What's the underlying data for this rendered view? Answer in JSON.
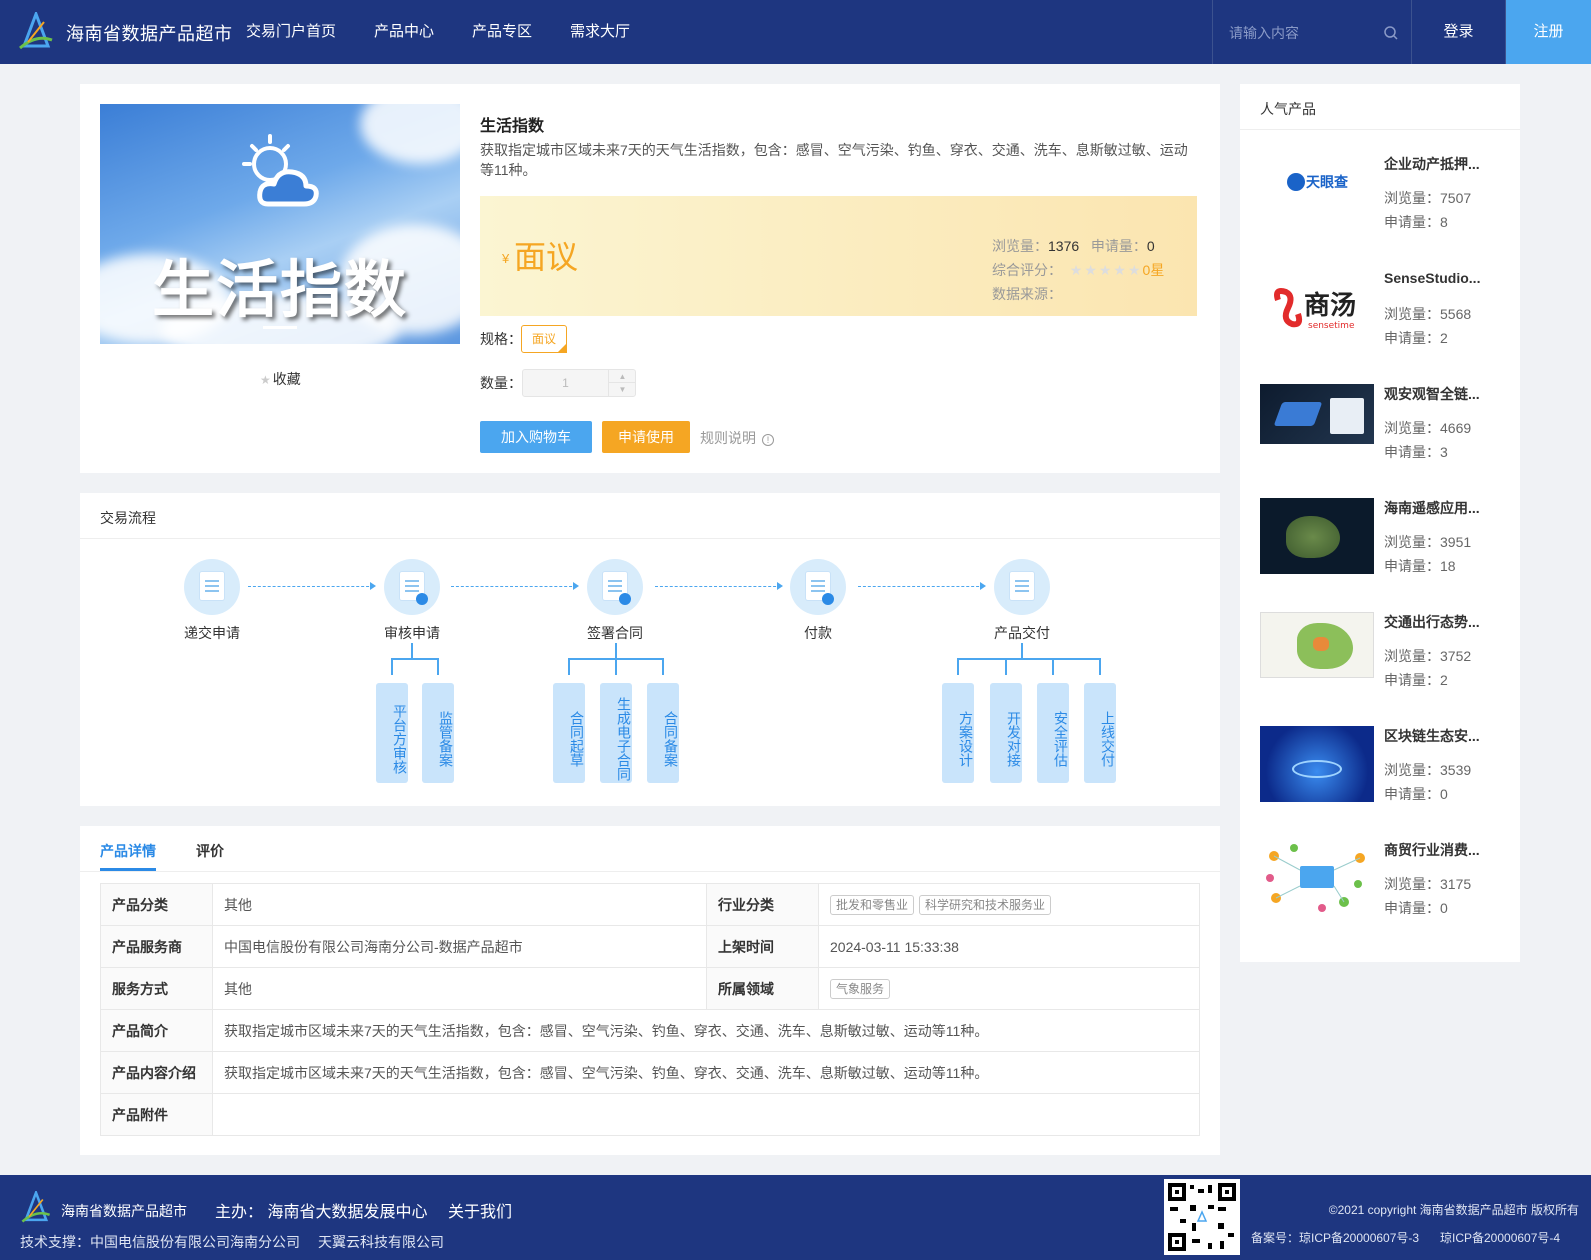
{
  "header": {
    "brand": "海南省数据产品超市",
    "nav": [
      "交易门户首页",
      "产品中心",
      "产品专区",
      "需求大厅"
    ],
    "search_placeholder": "请输入内容",
    "login": "登录",
    "register": "注册",
    "colors": {
      "primary": "#1e3680",
      "accent": "#4ba6ef"
    }
  },
  "product": {
    "image_text": "生活指数",
    "favorite": "收藏",
    "title": "生活指数",
    "description": "获取指定城市区域未来7天的天气生活指数，包含：感冒、空气污染、钓鱼、穿衣、交通、洗车、息斯敏过敏、运动等11种。",
    "currency": "¥",
    "price": "面议",
    "views_label": "浏览量：",
    "views": "1376",
    "applies_label": "申请量：",
    "applies": "0",
    "rating_label": "综合评分：",
    "rating": "0星",
    "source_label": "数据来源：",
    "source": "",
    "spec_label": "规格：",
    "spec": "面议",
    "qty_label": "数量：",
    "qty": "1",
    "add_cart": "加入购物车",
    "apply": "申请使用",
    "rules": "规则说明",
    "price_color": "#f5a623"
  },
  "process": {
    "title": "交易流程",
    "steps": [
      "递交申请",
      "审核申请",
      "签署合同",
      "付款",
      "产品交付"
    ],
    "sub_audit": [
      "平台方审核",
      "监管备案"
    ],
    "sub_contract": [
      "合同起草",
      "生成电子合同",
      "合同备案"
    ],
    "sub_delivery": [
      "方案设计",
      "开发对接",
      "安全评估",
      "上线交付"
    ]
  },
  "detail": {
    "tabs": [
      "产品详情",
      "评价"
    ],
    "rows": {
      "category_k": "产品分类",
      "category_v": "其他",
      "industry_k": "行业分类",
      "industry_tags": [
        "批发和零售业",
        "科学研究和技术服务业"
      ],
      "provider_k": "产品服务商",
      "provider_v": "中国电信股份有限公司海南分公司-数据产品超市",
      "online_k": "上架时间",
      "online_v": "2024-03-11 15:33:38",
      "service_k": "服务方式",
      "service_v": "其他",
      "field_k": "所属领域",
      "field_tags": [
        "气象服务"
      ],
      "intro_k": "产品简介",
      "intro_v": "获取指定城市区域未来7天的天气生活指数，包含：感冒、空气污染、钓鱼、穿衣、交通、洗车、息斯敏过敏、运动等11种。",
      "content_k": "产品内容介绍",
      "content_v": "获取指定城市区域未来7天的天气生活指数，包含：感冒、空气污染、钓鱼、穿衣、交通、洗车、息斯敏过敏、运动等11种。",
      "attach_k": "产品附件",
      "attach_v": ""
    }
  },
  "popular": {
    "title": "人气产品",
    "views_label": "浏览量：",
    "applies_label": "申请量：",
    "items": [
      {
        "name": "企业动产抵押...",
        "views": "7507",
        "applies": "8",
        "thumb": "tianyancha-logo"
      },
      {
        "name": "SenseStudio...",
        "views": "5568",
        "applies": "2",
        "thumb": "sensetime-logo"
      },
      {
        "name": "观安观智全链...",
        "views": "4669",
        "applies": "3",
        "thumb": "dashboard-screenshot"
      },
      {
        "name": "海南遥感应用...",
        "views": "3951",
        "applies": "18",
        "thumb": "satellite-map"
      },
      {
        "name": "交通出行态势...",
        "views": "3752",
        "applies": "2",
        "thumb": "traffic-map"
      },
      {
        "name": "区块链生态安...",
        "views": "3539",
        "applies": "0",
        "thumb": "blockchain-art"
      },
      {
        "name": "商贸行业消费...",
        "views": "3175",
        "applies": "0",
        "thumb": "network-diagram"
      }
    ],
    "logo_text_1": "天眼查",
    "logo_text_2": "商汤",
    "logo_text_2b": "sensetime"
  },
  "footer": {
    "brand": "海南省数据产品超市",
    "host": "主办： 海南省大数据发展中心",
    "about": "关于我们",
    "tech": "技术支撑：中国电信股份有限公司海南分公司",
    "tech2": "天翼云科技有限公司",
    "copyright": "©2021 copyright 海南省数据产品超市 版权所有",
    "icp1": "备案号：琼ICP备20000607号-3",
    "icp2": "琼ICP备20000607号-4"
  }
}
